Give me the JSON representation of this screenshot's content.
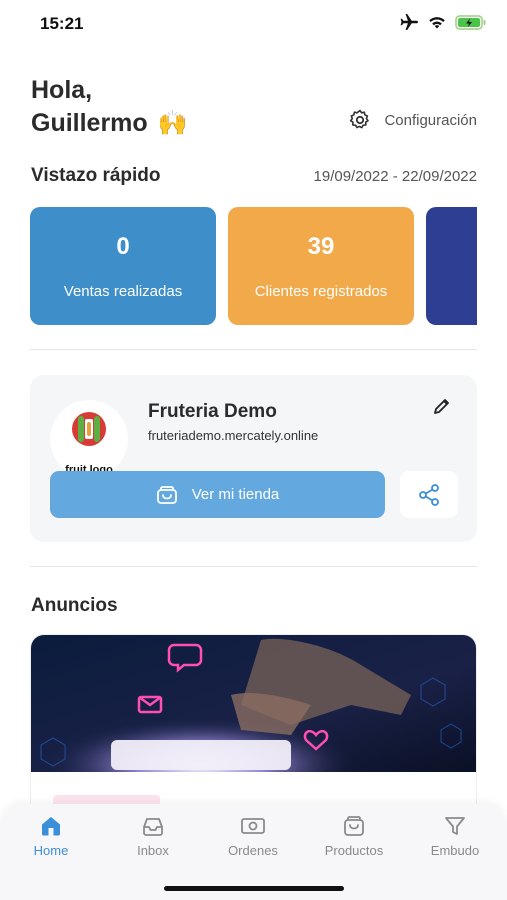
{
  "status": {
    "time": "15:21"
  },
  "header": {
    "greeting_line1": "Hola,",
    "greeting_name": "Guillermo",
    "greeting_emoji": "🙌",
    "config_label": "Configuración"
  },
  "quick_view": {
    "title": "Vistazo rápido",
    "date_range": "19/09/2022 - 22/09/2022",
    "cards": [
      {
        "value": "0",
        "label": "Ventas realizadas",
        "color": "#3d8ec9"
      },
      {
        "value": "39",
        "label": "Clientes registrados",
        "color": "#f1a94a"
      },
      {
        "value": "",
        "label": "",
        "color": "#2e3f93"
      }
    ]
  },
  "store": {
    "logo_text": "fruit logo",
    "name": "Fruteria Demo",
    "url": "fruteriademo.mercately.online",
    "view_store_label": "Ver mi tienda"
  },
  "announcements": {
    "title": "Anuncios"
  },
  "tabs": [
    {
      "label": "Home",
      "icon": "home-icon",
      "active": true
    },
    {
      "label": "Inbox",
      "icon": "inbox-icon",
      "active": false
    },
    {
      "label": "Ordenes",
      "icon": "money-icon",
      "active": false
    },
    {
      "label": "Productos",
      "icon": "bag-icon",
      "active": false
    },
    {
      "label": "Embudo",
      "icon": "funnel-icon",
      "active": false
    }
  ],
  "colors": {
    "accent": "#3b8ed8",
    "button": "#64a8e0"
  }
}
